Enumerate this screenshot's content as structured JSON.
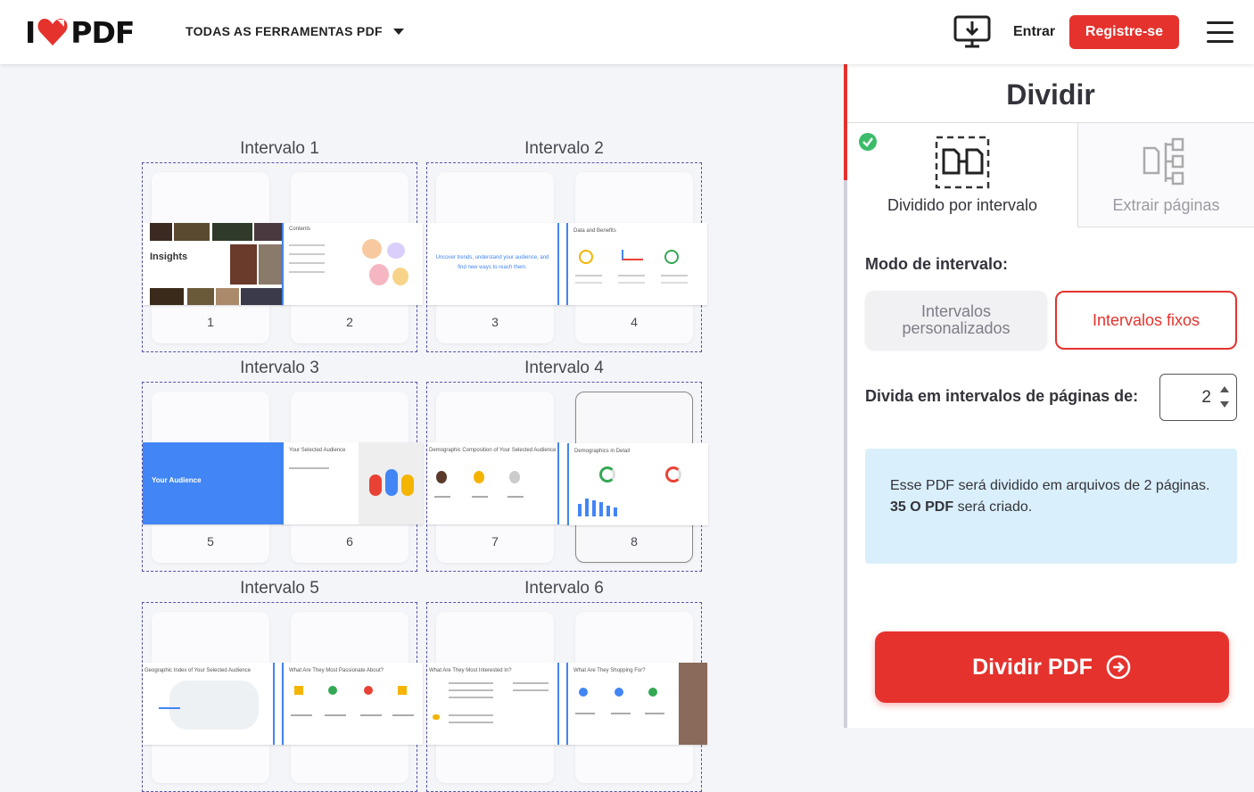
{
  "header": {
    "logo_left": "I",
    "logo_right": "PDF",
    "tools_menu_label": "TODAS AS FERRAMENTAS PDF",
    "login_label": "Entrar",
    "signup_label": "Registre-se",
    "brand_color": "#e5322d"
  },
  "ranges": [
    {
      "title": "Intervalo 1",
      "pages": [
        "1",
        "2"
      ]
    },
    {
      "title": "Intervalo 2",
      "pages": [
        "3",
        "4"
      ]
    },
    {
      "title": "Intervalo 3",
      "pages": [
        "5",
        "6"
      ]
    },
    {
      "title": "Intervalo 4",
      "pages": [
        "7",
        "8"
      ]
    },
    {
      "title": "Intervalo 5",
      "pages": [
        "",
        ""
      ]
    },
    {
      "title": "Intervalo 6",
      "pages": [
        "",
        ""
      ]
    }
  ],
  "slides": {
    "s1_title": "Insights",
    "s2_title": "Contents",
    "s3_text": "Uncover trends, understand your audience, and find new ways to reach them.",
    "s4_title": "Data and Benefits",
    "s5_title": "Your Audience",
    "s6_title": "Your Selected Audience",
    "s7_title": "Demographic Composition of Your Selected Audience",
    "s8_title": "Demographics in Detail",
    "s9_title": "Geographic Index of Your Selected Audience",
    "s10_title": "What Are They Most Passionate About?",
    "s11_title": "What Are They Most Interested In?",
    "s12_title": "What Are They Shopping For?"
  },
  "sidebar": {
    "title": "Dividir",
    "tab_active": "Dividido por intervalo",
    "tab_inactive": "Extrair páginas",
    "mode_label": "Modo de intervalo:",
    "opt_custom": "Intervalos personalizados",
    "opt_fixed": "Intervalos fixos",
    "split_label": "Divida em intervalos de páginas de:",
    "split_value": "2",
    "info_line1": "Esse PDF será dividido em arquivos de 2 páginas.",
    "info_bold": "35 O PDF",
    "info_line2": " será criado.",
    "action_label": "Dividir PDF"
  }
}
